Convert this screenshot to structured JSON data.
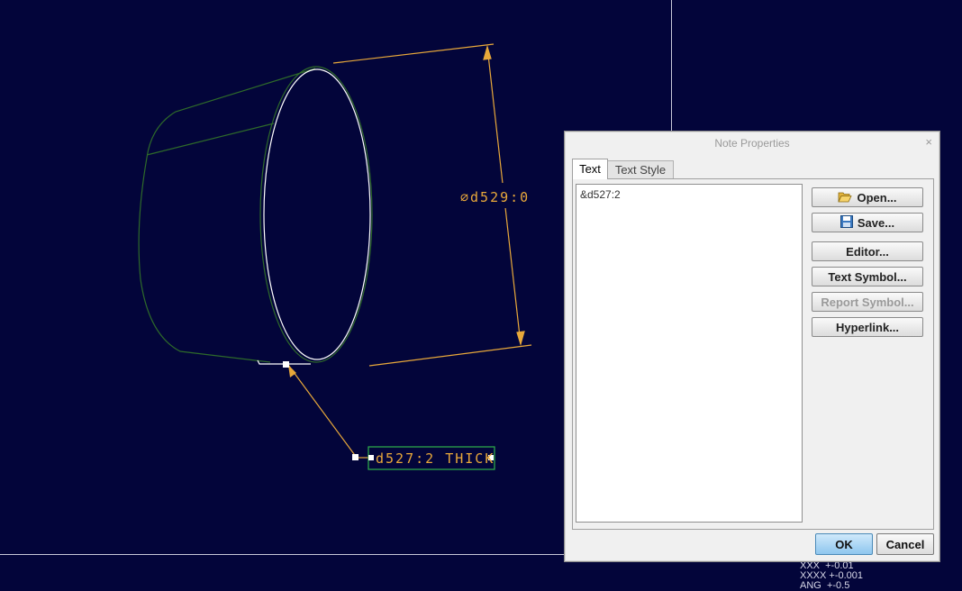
{
  "drawing": {
    "diameter_dim": "∅d529:0",
    "thick_note": "d527:2 THICK"
  },
  "tolerances": [
    "XXX  +-0.01",
    "XXXX +-0.001",
    "ANG  +-0.5"
  ],
  "dialog": {
    "title": "Note Properties",
    "close_label": "×",
    "tabs": [
      {
        "label": "Text",
        "active": true
      },
      {
        "label": "Text Style",
        "active": false
      }
    ],
    "note_text": "&d527:2",
    "buttons": {
      "open": "Open...",
      "save": "Save...",
      "editor": "Editor...",
      "text_symbol": "Text Symbol...",
      "report_symbol": "Report Symbol...",
      "hyperlink": "Hyperlink..."
    },
    "ok": "OK",
    "cancel": "Cancel"
  },
  "colors": {
    "background": "#03053a",
    "dimension": "#e8a83a",
    "edge": "#2e6a2a",
    "highlight": "#ffffff"
  }
}
